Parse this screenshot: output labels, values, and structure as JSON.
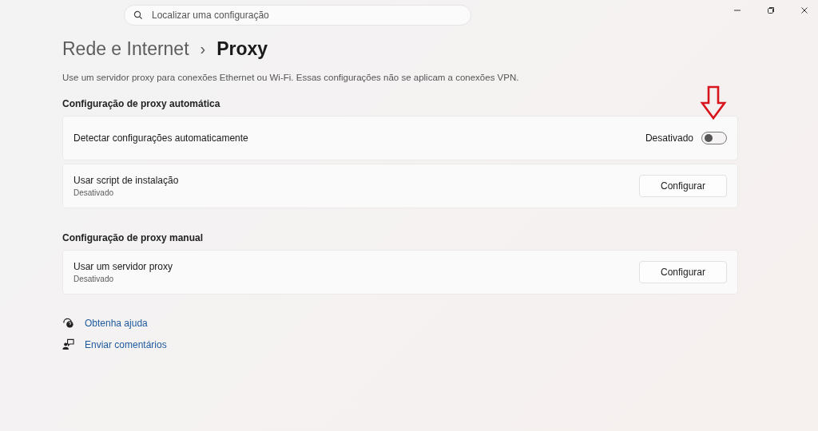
{
  "search": {
    "placeholder": "Localizar uma configuração"
  },
  "breadcrumb": {
    "parent": "Rede e Internet",
    "separator": "›",
    "current": "Proxy"
  },
  "description": "Use um servidor proxy para conexões Ethernet ou Wi-Fi. Essas configurações não se aplicam a conexões VPN.",
  "sections": [
    {
      "heading": "Configuração de proxy automática",
      "items": [
        {
          "kind": "toggle",
          "title": "Detectar configurações automaticamente",
          "state_label": "Desativado",
          "on": false,
          "annotated": true
        },
        {
          "kind": "button",
          "title": "Usar script de instalação",
          "subtitle": "Desativado",
          "button": "Configurar"
        }
      ]
    },
    {
      "heading": "Configuração de proxy manual",
      "items": [
        {
          "kind": "button",
          "title": "Usar um servidor proxy",
          "subtitle": "Desativado",
          "button": "Configurar"
        }
      ]
    }
  ],
  "links": [
    {
      "kind": "help",
      "label": "Obtenha ajuda"
    },
    {
      "kind": "feedback",
      "label": "Enviar comentários"
    }
  ]
}
